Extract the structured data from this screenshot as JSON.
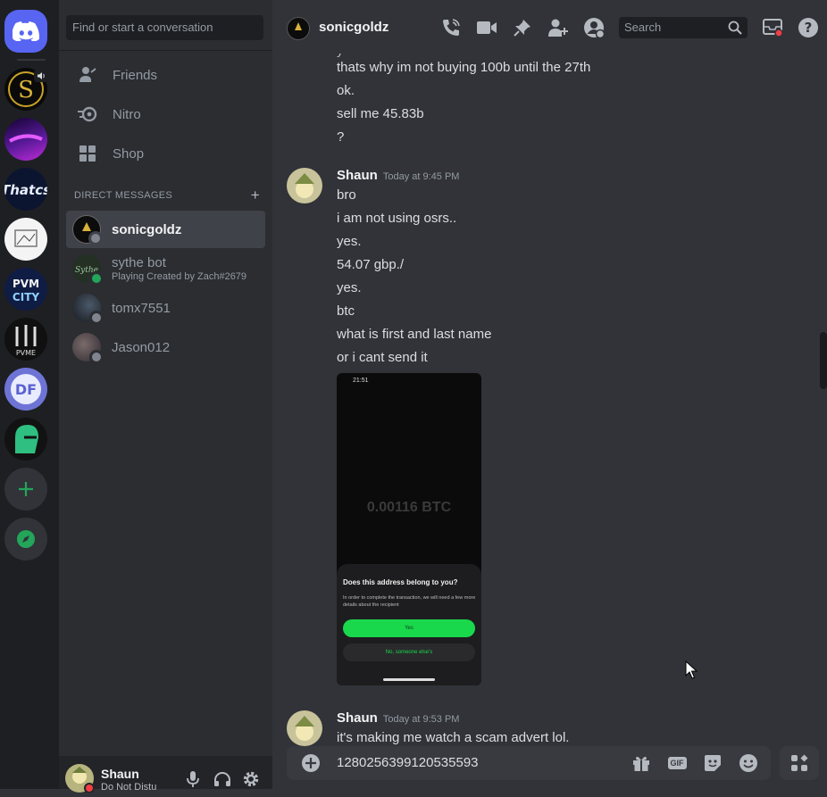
{
  "sidebar": {
    "find_placeholder": "Find or start a conversation",
    "nav": [
      {
        "label": "Friends",
        "icon": "friends-icon"
      },
      {
        "label": "Nitro",
        "icon": "nitro-icon"
      },
      {
        "label": "Shop",
        "icon": "shop-icon"
      }
    ],
    "dm_header": "DIRECT MESSAGES",
    "dm_add": "+",
    "dms": [
      {
        "name": "sonicgoldz",
        "subtitle": "",
        "status": "offline",
        "active": true
      },
      {
        "name": "sythe bot",
        "subtitle": "Playing Created by Zach#2679",
        "status": "online",
        "active": false
      },
      {
        "name": "tomx7551",
        "subtitle": "",
        "status": "offline",
        "active": false
      },
      {
        "name": "Jason012",
        "subtitle": "",
        "status": "offline",
        "active": false
      }
    ]
  },
  "user_panel": {
    "name": "Shaun",
    "status": "Do Not Distu"
  },
  "header": {
    "channel_name": "sonicgoldz",
    "search_placeholder": "Search"
  },
  "messages": {
    "continued_lines": [
      "thats why im not buying 100b until the 27th",
      "ok.",
      "sell me 45.83b",
      "?"
    ],
    "groups": [
      {
        "author": "Shaun",
        "timestamp": "Today at 9:45 PM",
        "lines": [
          "bro",
          "i am not using osrs..",
          "yes.",
          "54.07 gbp./",
          "yes.",
          "btc",
          "what is first and last name",
          "or i cant send it"
        ],
        "attachment": {
          "time": "21:51",
          "amount": "0.00116 BTC",
          "dialog_title": "Does this address belong to you?",
          "dialog_body": "In order to complete the transaction, we will need a few more details about the recipient",
          "yes_label": "Yes",
          "no_label": "No, someone else's"
        }
      },
      {
        "author": "Shaun",
        "timestamp": "Today at 9:53 PM",
        "lines": [
          "it's making me watch a scam advert lol."
        ]
      }
    ]
  },
  "composer": {
    "text": "1280256399120535593",
    "gif_label": "GIF"
  },
  "colors": {
    "blurple": "#5865f2",
    "online": "#23a55a",
    "offline": "#80848e",
    "dnd": "#f23f43",
    "cashapp_green": "#1ad84c"
  }
}
